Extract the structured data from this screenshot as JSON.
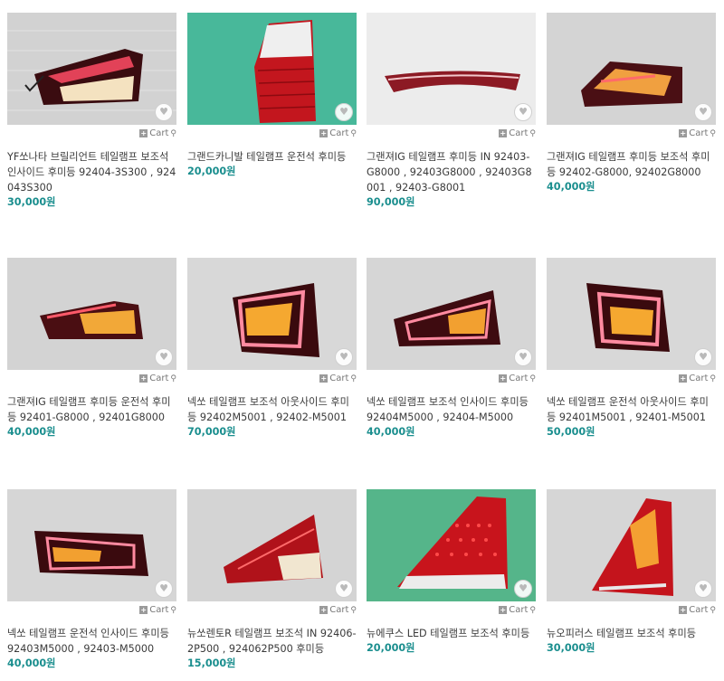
{
  "ui": {
    "cart_label": "Cart",
    "heart_icon": "heart-icon",
    "zoom_icon": "magnifier-icon",
    "price_color": "#1a8e8e"
  },
  "products": [
    {
      "title": "YF쏘나타 브릴리언트 테일램프 보조석 인사이드 후미등 92404-3S300 , 924043S300",
      "price": "30,000원"
    },
    {
      "title": "그랜드카니발 테일램프 운전석 후미등",
      "price": "20,000원"
    },
    {
      "title": "그랜져IG 테일램프 후미등 IN 92403-G8000 , 92403G8000 , 92403G8001 , 92403-G8001",
      "price": "90,000원"
    },
    {
      "title": "그랜져IG 테일램프 후미등 보조석 후미등 92402-G8000, 92402G8000",
      "price": "40,000원"
    },
    {
      "title": "그랜져IG 테일램프 후미등 운전석 후미등 92401-G8000 , 92401G8000",
      "price": "40,000원"
    },
    {
      "title": "넥쏘 테일램프 보조석 아웃사이드 후미등 92402M5001 , 92402-M5001",
      "price": "70,000원"
    },
    {
      "title": "넥쏘 테일램프 보조석 인사이드 후미등 92404M5000 , 92404-M5000",
      "price": "40,000원"
    },
    {
      "title": "넥쏘 테일램프 운전석 아웃사이드 후미등 92401M5001 , 92401-M5001",
      "price": "50,000원"
    },
    {
      "title": "넥쏘 테일램프 운전석 인사이드 후미등 92403M5000 , 92403-M5000",
      "price": "40,000원"
    },
    {
      "title": "뉴쏘렌토R 테일램프 보조석 IN 92406-2P500 , 924062P500 후미등",
      "price": "15,000원"
    },
    {
      "title": "뉴에쿠스 LED 테일램프 보조석 후미등",
      "price": "20,000원"
    },
    {
      "title": "뉴오피러스 테일램프 보조석 후미등",
      "price": "30,000원"
    }
  ]
}
